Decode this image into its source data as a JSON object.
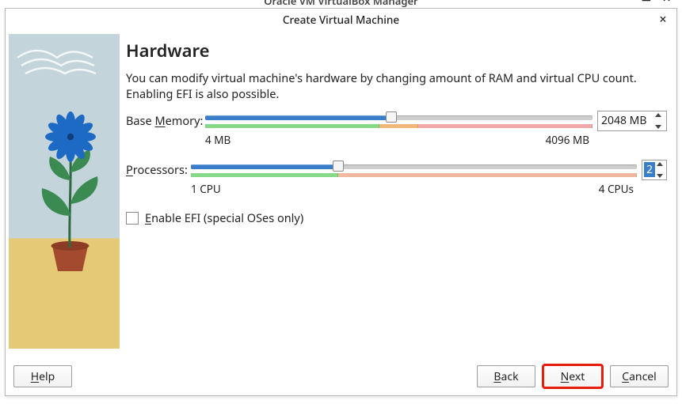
{
  "parent_window": {
    "title": "Oracle VM VirtualBox Manager"
  },
  "dialog": {
    "title": "Create Virtual Machine"
  },
  "page": {
    "heading": "Hardware",
    "description": "You can modify virtual machine's hardware by changing amount of RAM and virtual CPU count. Enabling EFI is also possible."
  },
  "memory": {
    "label_prefix": "Base ",
    "label_u": "M",
    "label_suffix": "emory:",
    "value_text": "2048 MB",
    "value": 2048,
    "min": 4,
    "max_display": 4096,
    "min_label": "4 MB",
    "max_label": "4096 MB",
    "fill_percent": 48,
    "scale": {
      "green_end_pct": 45,
      "orange_end_pct": 55
    }
  },
  "processors": {
    "label_u": "P",
    "label_suffix": "rocessors:",
    "value_text": "2",
    "value": 2,
    "min_label": "1 CPU",
    "max_label": "4 CPUs",
    "fill_percent": 33,
    "scale": {
      "green_end_pct": 33,
      "orange_end_pct": 100
    }
  },
  "efi": {
    "checked": false,
    "label_u": "E",
    "label_suffix": "nable EFI (special OSes only)"
  },
  "buttons": {
    "help_u": "H",
    "help_suffix": "elp",
    "back_u": "B",
    "back_suffix": "ack",
    "next_u": "N",
    "next_suffix": "ext",
    "cancel_u": "C",
    "cancel_suffix": "ancel"
  }
}
